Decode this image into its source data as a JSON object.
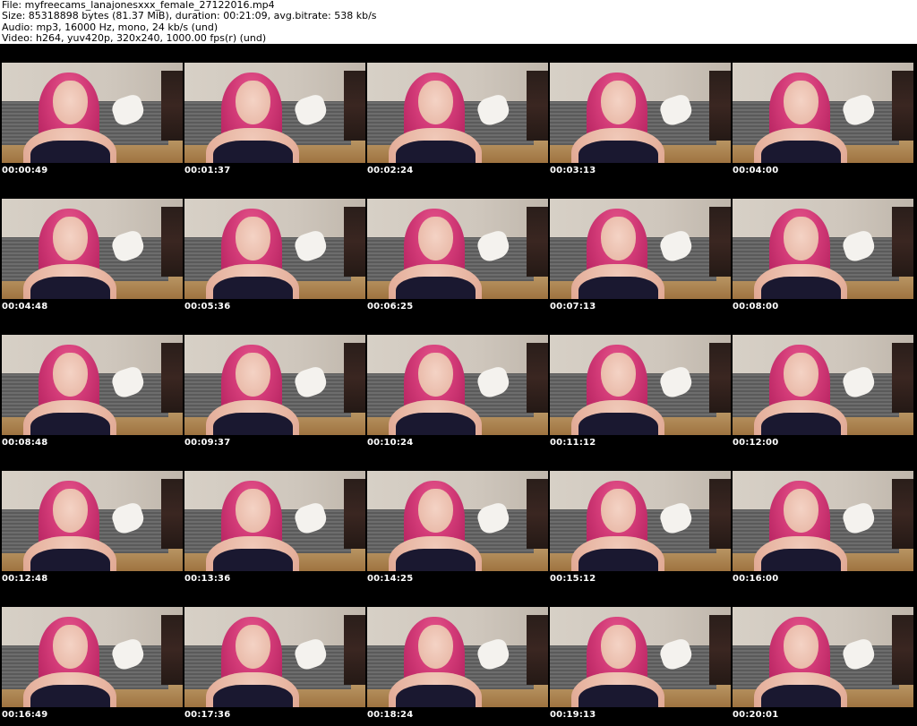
{
  "header": {
    "file_line": "File: myfreecams_lanajonesxxx_female_27122016.mp4",
    "size_line": "Size: 85318898 bytes (81.37 MiB), duration: 00:21:09, avg.bitrate: 538 kb/s",
    "audio_line": "Audio: mp3, 16000 Hz, mono, 24 kb/s (und)",
    "video_line": "Video: h264, yuv420p, 320x240, 1000.00 fps(r) (und)"
  },
  "frames": [
    {
      "time": "00:00:49"
    },
    {
      "time": "00:01:37"
    },
    {
      "time": "00:02:24"
    },
    {
      "time": "00:03:13"
    },
    {
      "time": "00:04:00"
    },
    {
      "time": "00:04:48"
    },
    {
      "time": "00:05:36"
    },
    {
      "time": "00:06:25"
    },
    {
      "time": "00:07:13"
    },
    {
      "time": "00:08:00"
    },
    {
      "time": "00:08:48"
    },
    {
      "time": "00:09:37"
    },
    {
      "time": "00:10:24"
    },
    {
      "time": "00:11:12"
    },
    {
      "time": "00:12:00"
    },
    {
      "time": "00:12:48"
    },
    {
      "time": "00:13:36"
    },
    {
      "time": "00:14:25"
    },
    {
      "time": "00:15:12"
    },
    {
      "time": "00:16:00"
    },
    {
      "time": "00:16:49"
    },
    {
      "time": "00:17:36"
    },
    {
      "time": "00:18:24"
    },
    {
      "time": "00:19:13"
    },
    {
      "time": "00:20:01"
    }
  ]
}
